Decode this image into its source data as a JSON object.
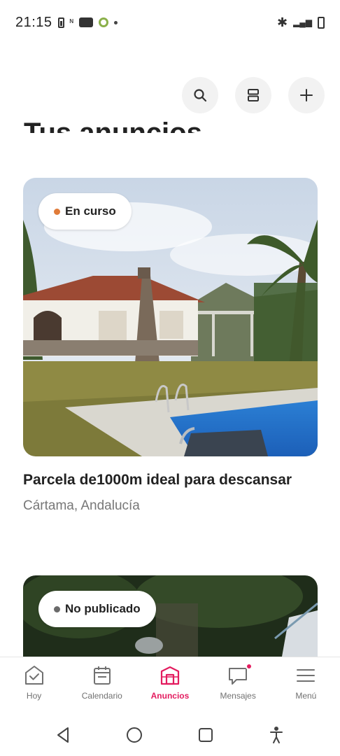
{
  "status_bar": {
    "time": "21:15",
    "icons": [
      "battery-saver-icon",
      "nfc-icon",
      "youtube-icon",
      "app-green-icon",
      "dot-icon"
    ],
    "right_icons": [
      "bluetooth-icon",
      "signal-icon",
      "battery-icon"
    ]
  },
  "header": {
    "title": "Tus anuncios",
    "actions": [
      "search-icon",
      "view-toggle-icon",
      "add-icon"
    ]
  },
  "listings": [
    {
      "status": "En curso",
      "status_color": "#e07b39",
      "title": "Parcela de1000m ideal para descansar",
      "location": "Cártama, Andalucía"
    },
    {
      "status": "No publicado",
      "status_color": "#6a6a6a"
    }
  ],
  "bottom_nav": {
    "items": [
      {
        "label": "Hoy",
        "icon": "today-check-icon"
      },
      {
        "label": "Calendario",
        "icon": "calendar-icon"
      },
      {
        "label": "Anuncios",
        "icon": "listings-house-icon",
        "active": true
      },
      {
        "label": "Mensajes",
        "icon": "messages-icon",
        "badge": true
      },
      {
        "label": "Menú",
        "icon": "menu-icon"
      }
    ]
  },
  "colors": {
    "accent": "#e31c5f",
    "text": "#222222",
    "muted": "#717171"
  }
}
